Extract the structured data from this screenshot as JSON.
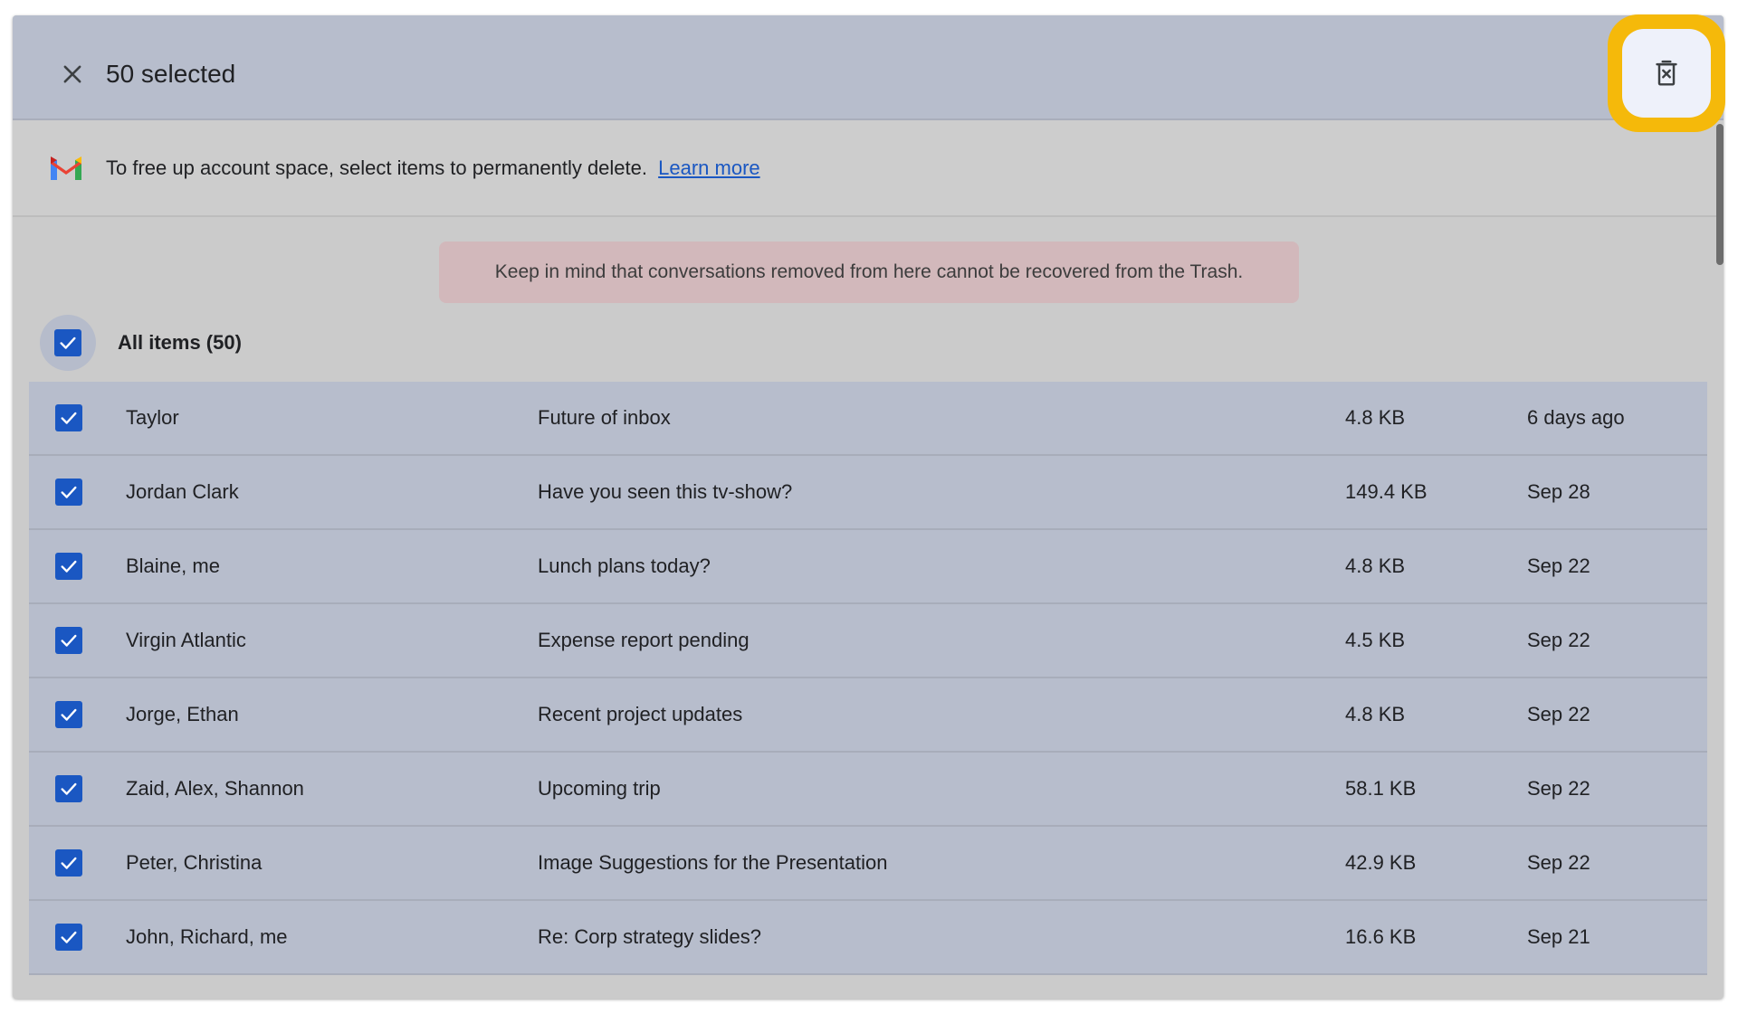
{
  "header": {
    "selected_text": "50 selected",
    "close_icon": "close-icon",
    "delete_icon": "delete-forever-icon"
  },
  "banner": {
    "text": "To free up account space, select items to permanently delete.",
    "link": "Learn more",
    "logo": "gmail-logo-icon"
  },
  "warning": {
    "text": "Keep in mind that conversations removed from here cannot be recovered from the Trash."
  },
  "select_all": {
    "label": "All items (50)",
    "checked": true
  },
  "rows": [
    {
      "sender": "Taylor",
      "subject": "Future of inbox",
      "size": "4.8 KB",
      "date": "6 days ago",
      "checked": true
    },
    {
      "sender": "Jordan Clark",
      "subject": "Have you seen this tv-show?",
      "size": "149.4 KB",
      "date": "Sep 28",
      "checked": true
    },
    {
      "sender": "Blaine, me",
      "subject": "Lunch plans today?",
      "size": "4.8 KB",
      "date": "Sep 22",
      "checked": true
    },
    {
      "sender": "Virgin Atlantic",
      "subject": "Expense report pending",
      "size": "4.5 KB",
      "date": "Sep 22",
      "checked": true
    },
    {
      "sender": "Jorge, Ethan",
      "subject": "Recent project updates",
      "size": "4.8 KB",
      "date": "Sep 22",
      "checked": true
    },
    {
      "sender": "Zaid, Alex, Shannon",
      "subject": "Upcoming trip",
      "size": "58.1 KB",
      "date": "Sep 22",
      "checked": true
    },
    {
      "sender": "Peter, Christina",
      "subject": "Image Suggestions for the Presentation",
      "size": "42.9 KB",
      "date": "Sep 22",
      "checked": true
    },
    {
      "sender": "John, Richard, me",
      "subject": "Re: Corp strategy slides?",
      "size": "16.6 KB",
      "date": "Sep 21",
      "checked": true
    }
  ],
  "colors": {
    "accent": "#1a57c2",
    "highlight": "#f5b90a",
    "selected_row": "#b7bdcc",
    "warning_bg": "#d2b8bb"
  }
}
